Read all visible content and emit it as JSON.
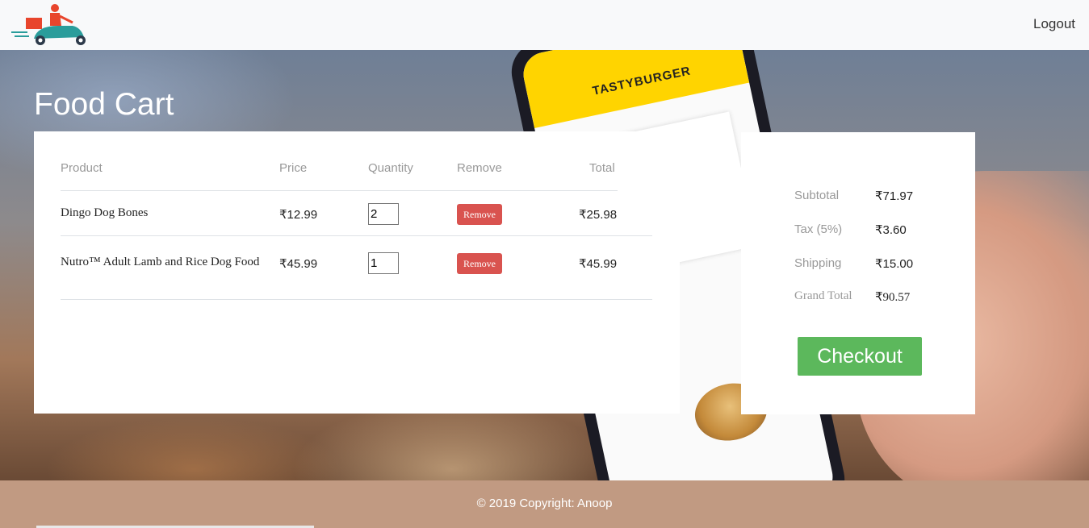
{
  "navbar": {
    "logo_icon": "delivery-scooter-logo",
    "logout_label": "Logout"
  },
  "page": {
    "title": "Food Cart"
  },
  "cart": {
    "headers": {
      "product": "Product",
      "price": "Price",
      "quantity": "Quantity",
      "remove": "Remove",
      "total": "Total"
    },
    "items": [
      {
        "name": "Dingo Dog Bones",
        "price": "₹12.99",
        "quantity": "2",
        "remove_label": "Remove",
        "total": "₹25.98"
      },
      {
        "name": "Nutro™ Adult Lamb and Rice Dog Food",
        "price": "₹45.99",
        "quantity": "1",
        "remove_label": "Remove",
        "total": "₹45.99"
      }
    ]
  },
  "summary": {
    "subtotal_label": "Subtotal",
    "subtotal_value": "₹71.97",
    "tax_label": "Tax (5%)",
    "tax_value": "₹3.60",
    "shipping_label": "Shipping",
    "shipping_value": "₹15.00",
    "grand_total_label": "Grand Total",
    "grand_total_value": "₹90.57",
    "checkout_label": "Checkout"
  },
  "hero_phone": {
    "brand": "TASTYBURGER"
  },
  "footer": {
    "copyright": "© 2019 Copyright: Anoop"
  },
  "colors": {
    "navbar_bg": "#f8f9fa",
    "remove_button": "#d9534f",
    "checkout_button": "#5cb85c",
    "footer_bg": "#c19a82"
  }
}
